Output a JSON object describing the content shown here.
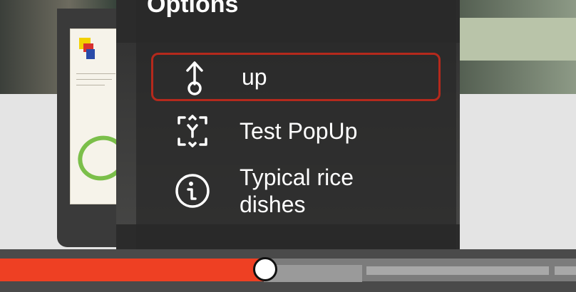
{
  "overlay": {
    "title": "Options",
    "items": [
      {
        "label": "up",
        "icon": "touch-up-icon",
        "selected": true
      },
      {
        "label": "Test PopUp",
        "icon": "popup-icon",
        "selected": false
      },
      {
        "label": "Typical rice dishes",
        "icon": "info-icon",
        "selected": false
      }
    ]
  },
  "player": {
    "progress_fraction": 0.46
  },
  "colors": {
    "accent": "#ee4023",
    "selection_border": "#b5291c",
    "panel_bg": "#282828"
  }
}
